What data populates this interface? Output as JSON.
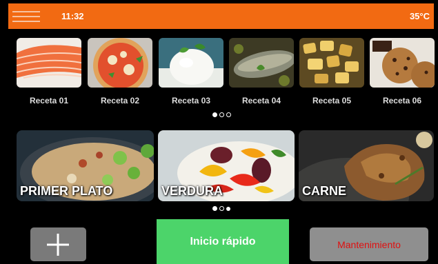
{
  "status_bar": {
    "time": "11:32",
    "temperature": "35°C"
  },
  "recipes": [
    {
      "label": "Receta 01",
      "image": "salmon"
    },
    {
      "label": "Receta 02",
      "image": "pizza"
    },
    {
      "label": "Receta 03",
      "image": "rice"
    },
    {
      "label": "Receta 04",
      "image": "fish"
    },
    {
      "label": "Receta 05",
      "image": "potatoes"
    },
    {
      "label": "Receta 06",
      "image": "cookies"
    }
  ],
  "recipe_pager": {
    "pages": 3,
    "active": 1
  },
  "categories": [
    {
      "label": "PRIMER PLATO",
      "image": "rice-vegetables"
    },
    {
      "label": "VERDURA",
      "image": "roasted-vegetables"
    },
    {
      "label": "CARNE",
      "image": "roast-chicken"
    }
  ],
  "category_pager": {
    "pages": 3,
    "active": 3
  },
  "buttons": {
    "add_icon": "plus-icon",
    "quick_start": "Inicio rápido",
    "maintenance": "Mantenimiento"
  },
  "colors": {
    "header": "#f26a12",
    "quick_start": "#4cd46a",
    "maintenance_text": "#e01010",
    "button_gray": "#7a7a7a"
  }
}
